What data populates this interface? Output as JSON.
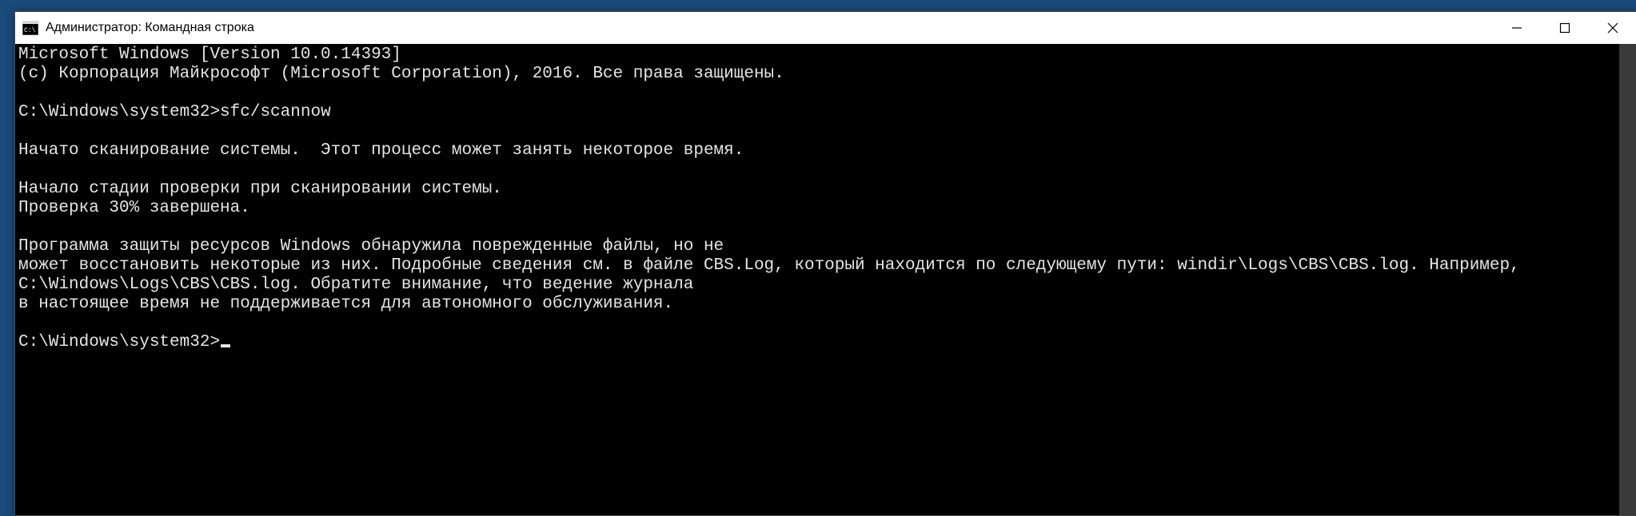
{
  "window": {
    "title": "Администратор: Командная строка"
  },
  "console": {
    "banner_line1": "Microsoft Windows [Version 10.0.14393]",
    "banner_line2": "(с) Корпорация Майкрософт (Microsoft Corporation), 2016. Все права защищены.",
    "prompt1": "C:\\Windows\\system32>",
    "command1": "sfc/scannow",
    "msg_scan_started": "Начато сканирование системы.  Этот процесс может занять некоторое время.",
    "msg_stage": "Начало стадии проверки при сканировании системы.",
    "msg_progress": "Проверка 30% завершена.",
    "msg_result1": "Программа защиты ресурсов Windows обнаружила поврежденные файлы, но не",
    "msg_result2": "может восстановить некоторые из них. Подробные сведения см. в файле CBS.Log, который находится по следующему пути: windir\\Logs\\CBS\\CBS.log. Например,",
    "msg_result3": "C:\\Windows\\Logs\\CBS\\CBS.log. Обратите внимание, что ведение журнала",
    "msg_result4": "в настоящее время не поддерживается для автономного обслуживания.",
    "prompt2": "C:\\Windows\\system32>"
  }
}
